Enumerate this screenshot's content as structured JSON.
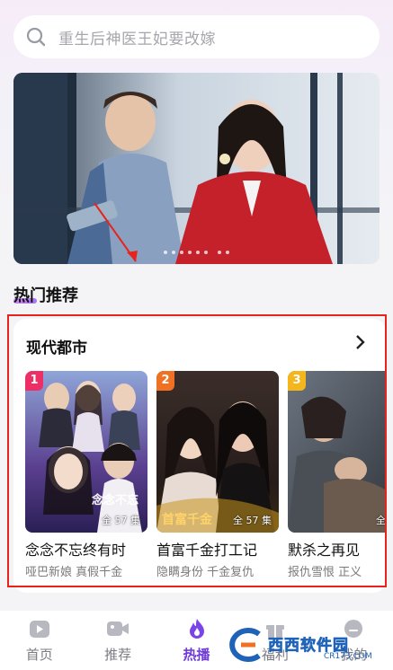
{
  "search": {
    "placeholder": "重生后神医王妃要改嫁"
  },
  "banner": {
    "dot_count": 8
  },
  "section": {
    "title": "热门推荐"
  },
  "card": {
    "title": "现代都市",
    "dramas": [
      {
        "rank": "1",
        "rank_color": "#ee2f66",
        "title": "念念不忘终有时",
        "tags": "哑巴新娘 真假千金",
        "episodes": "全 57 集"
      },
      {
        "rank": "2",
        "rank_color": "#f07124",
        "title": "首富千金打工记",
        "tags": "隐瞒身份 千金复仇",
        "episodes": "全 57 集"
      },
      {
        "rank": "3",
        "rank_color": "#f4b51d",
        "title": "默杀之再见",
        "tags": "报仇雪恨 正义",
        "episodes": "全"
      }
    ]
  },
  "tabs": [
    {
      "label": "首页",
      "icon": "home-icon"
    },
    {
      "label": "推荐",
      "icon": "video-icon"
    },
    {
      "label": "热播",
      "icon": "fire-icon"
    },
    {
      "label": "福利",
      "icon": "gift-icon"
    },
    {
      "label": "我的",
      "icon": "profile-icon"
    }
  ],
  "watermark": {
    "text": "西西软件园",
    "sub": "CR173.COM"
  },
  "colors": {
    "accent": "#6f3bd9",
    "highlight_frame": "#e8231c"
  }
}
